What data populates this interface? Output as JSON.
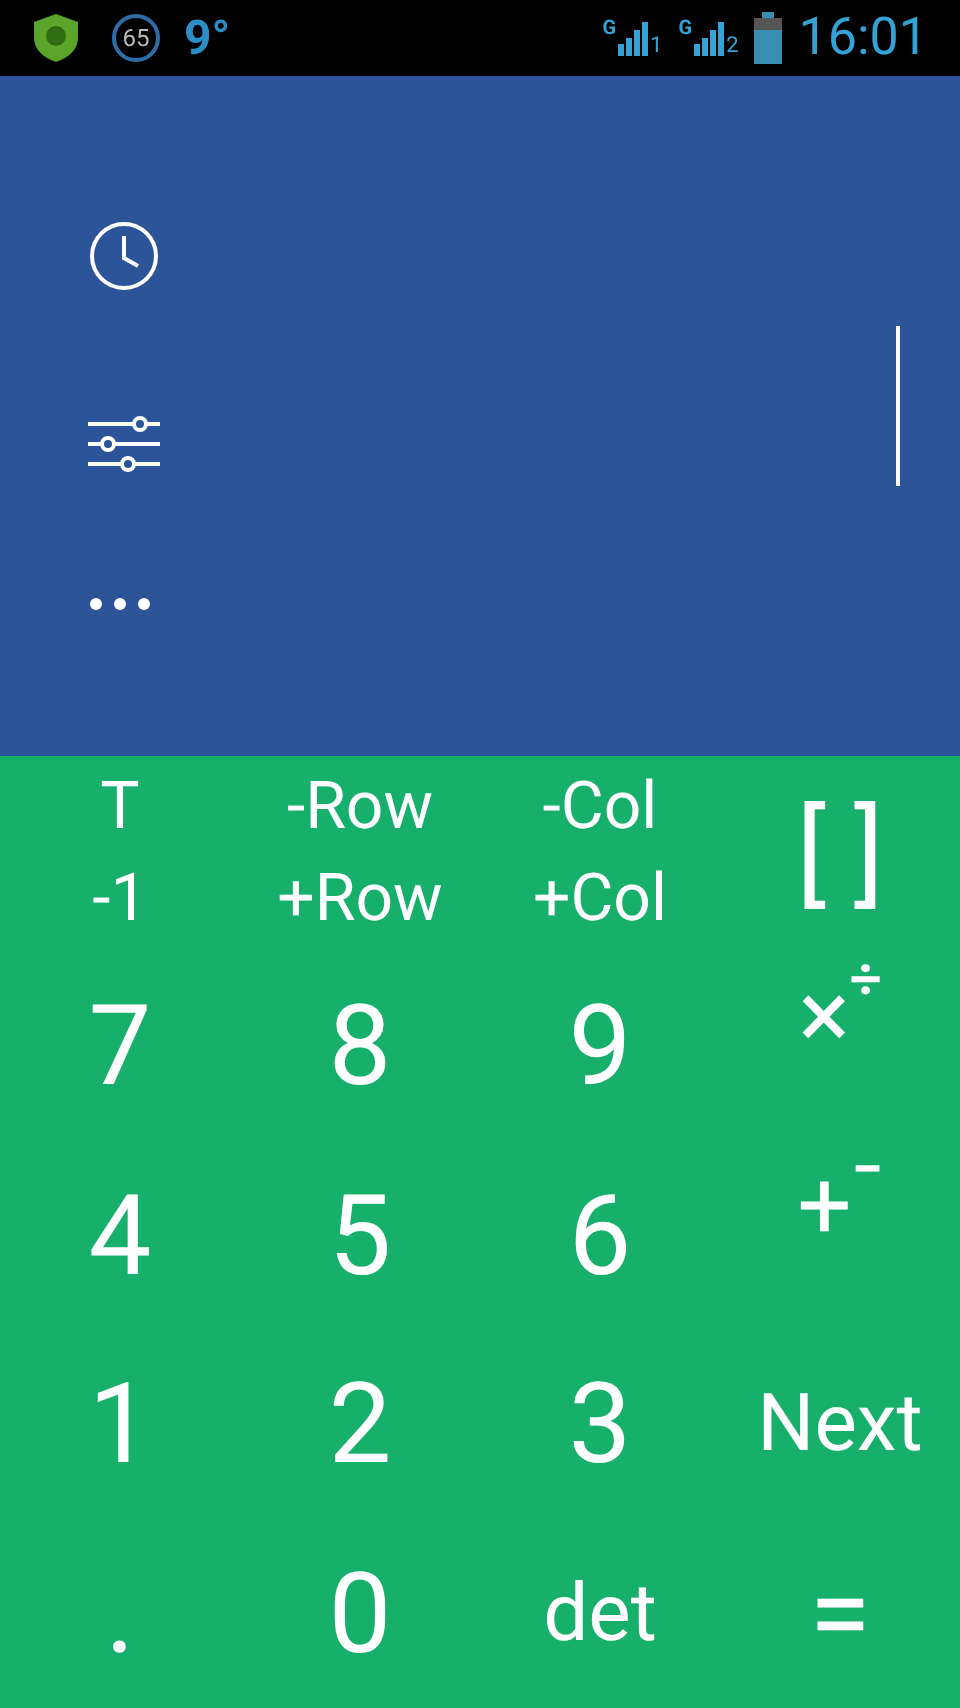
{
  "status_bar": {
    "badge": "65",
    "temperature": "9°",
    "sims": [
      {
        "network": "G",
        "slot": "1"
      },
      {
        "network": "G",
        "slot": "2"
      }
    ],
    "time": "16:01"
  },
  "keypad": [
    [
      {
        "kind": "stacked",
        "lines": [
          "T",
          "-1"
        ]
      },
      {
        "kind": "stacked",
        "lines": [
          "-Row",
          "+Row"
        ]
      },
      {
        "kind": "stacked",
        "lines": [
          "-Col",
          "+Col"
        ]
      },
      {
        "kind": "single",
        "label": "[ ]"
      }
    ],
    [
      {
        "kind": "single",
        "label": "7"
      },
      {
        "kind": "single",
        "label": "8"
      },
      {
        "kind": "single",
        "label": "9"
      },
      {
        "kind": "super",
        "label": "×",
        "super": "÷"
      }
    ],
    [
      {
        "kind": "single",
        "label": "4"
      },
      {
        "kind": "single",
        "label": "5"
      },
      {
        "kind": "single",
        "label": "6"
      },
      {
        "kind": "super",
        "label": "+",
        "super": "−"
      }
    ],
    [
      {
        "kind": "single",
        "label": "1"
      },
      {
        "kind": "single",
        "label": "2"
      },
      {
        "kind": "single",
        "label": "3"
      },
      {
        "kind": "word",
        "label": "Next"
      }
    ],
    [
      {
        "kind": "single",
        "label": "."
      },
      {
        "kind": "single",
        "label": "0"
      },
      {
        "kind": "word",
        "label": "det"
      },
      {
        "kind": "single",
        "label": "="
      }
    ]
  ]
}
